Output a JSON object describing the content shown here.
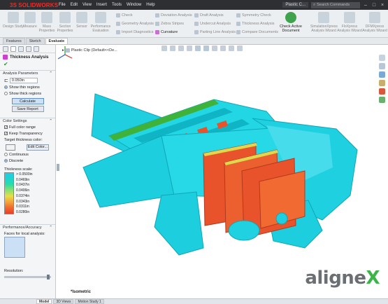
{
  "app": {
    "brand": "SOLIDWORKS",
    "brand_prefix": "3S",
    "doc_title": "Plastic C...",
    "search_placeholder": "Search Commands"
  },
  "menu": [
    "File",
    "Edit",
    "View",
    "Insert",
    "Tools",
    "Window",
    "Help"
  ],
  "ribbon": {
    "big_buttons": [
      "Design Study",
      "Measure",
      "Mass Properties",
      "Section Properties",
      "Sensor",
      "Performance Evaluation"
    ],
    "small_buttons": [
      {
        "label": "Check",
        "active": false
      },
      {
        "label": "Geometry Analysis",
        "active": false
      },
      {
        "label": "Import Diagnostics",
        "active": false
      },
      {
        "label": "Deviation Analysis",
        "active": false
      },
      {
        "label": "Zebra Stripes",
        "active": false
      },
      {
        "label": "Curvature",
        "active": true
      },
      {
        "label": "Draft Analysis",
        "active": false
      },
      {
        "label": "Undercut Analysis",
        "active": false
      },
      {
        "label": "Parting Line Analysis",
        "active": false
      },
      {
        "label": "Symmetry Check",
        "active": false
      },
      {
        "label": "Thickness Analysis",
        "active": false
      },
      {
        "label": "Compare Documents",
        "active": false
      }
    ],
    "active_doc_label": "Check Active Document",
    "right_buttons": [
      "SimulationXpress Analysis Wizard",
      "FloXpress Analysis Wizard",
      "DFMXpress Analysis Wizard"
    ]
  },
  "tabs": [
    "Features",
    "Sketch",
    "Evaluate"
  ],
  "active_tab": "Evaluate",
  "panel": {
    "title": "Thickness Analysis",
    "params_header": "Analysis Parameters",
    "thickness_value": "0.050in",
    "show_thin": "Show thin regions",
    "show_thick": "Show thick regions",
    "calculate": "Calculate",
    "save_report": "Save Report",
    "color_header": "Color Settings",
    "full_color": "Full color range",
    "keep_transparency": "Keep Transparency",
    "target_color": "Target thickness color:",
    "edit_color": "Edit Color...",
    "continuous": "Continuous",
    "discrete": "Discrete",
    "scale_label": "Thickness scale:",
    "scale_values": [
      "> 0.0500in",
      "0.0469in",
      "0.0437in",
      "0.0406in",
      "0.0374in",
      "0.0343in",
      "0.0311in",
      "0.0280in"
    ],
    "perf_header": "Performance/Accuracy",
    "faces_label": "Faces for local analysis:",
    "resolution_label": "Resolution:"
  },
  "viewport": {
    "tree_label": "Plastic Clip (Default<<De...",
    "view_label": "*Isometric",
    "watermark_a": "aligne",
    "watermark_b": "X",
    "colors": {
      "part": "#1fd4de",
      "thin": "#e8532c",
      "rim": "#3fb23a"
    }
  },
  "bottom_tabs": [
    "Model",
    "3D Views",
    "Motion Study 1"
  ],
  "active_bottom": "Model"
}
